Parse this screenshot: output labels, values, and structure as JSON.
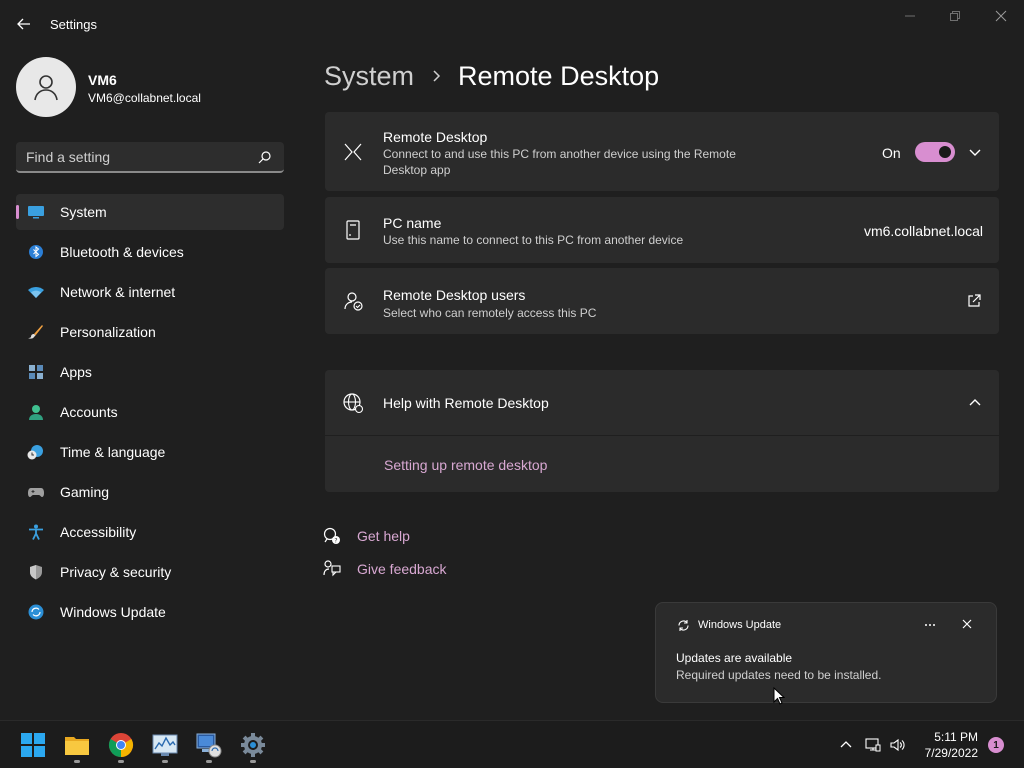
{
  "window": {
    "title": "Settings",
    "icons": [
      "back-arrow-icon",
      "minimize-icon",
      "maximize-icon",
      "close-icon"
    ]
  },
  "profile": {
    "name": "VM6",
    "email": "VM6@collabnet.local"
  },
  "search": {
    "placeholder": "Find a setting"
  },
  "nav": {
    "items": [
      {
        "label": "System",
        "icon": "monitor-icon",
        "selected": true
      },
      {
        "label": "Bluetooth & devices",
        "icon": "bluetooth-icon"
      },
      {
        "label": "Network & internet",
        "icon": "wifi-icon"
      },
      {
        "label": "Personalization",
        "icon": "brush-icon"
      },
      {
        "label": "Apps",
        "icon": "apps-icon"
      },
      {
        "label": "Accounts",
        "icon": "person-icon"
      },
      {
        "label": "Time & language",
        "icon": "clock-globe-icon"
      },
      {
        "label": "Gaming",
        "icon": "gamepad-icon"
      },
      {
        "label": "Accessibility",
        "icon": "accessibility-icon"
      },
      {
        "label": "Privacy & security",
        "icon": "shield-icon"
      },
      {
        "label": "Windows Update",
        "icon": "update-icon"
      }
    ]
  },
  "breadcrumb": {
    "parent": "System",
    "current": "Remote Desktop"
  },
  "cards": {
    "remote_desktop": {
      "title": "Remote Desktop",
      "description": "Connect to and use this PC from another device using the Remote Desktop app",
      "toggle_label": "On",
      "toggle_on": true
    },
    "pc_name": {
      "title": "PC name",
      "description": "Use this name to connect to this PC from another device",
      "value": "vm6.collabnet.local"
    },
    "users": {
      "title": "Remote Desktop users",
      "description": "Select who can remotely access this PC"
    },
    "help": {
      "title": "Help with Remote Desktop",
      "link": "Setting up remote desktop"
    }
  },
  "footer_links": {
    "get_help": "Get help",
    "give_feedback": "Give feedback"
  },
  "toast": {
    "app_name": "Windows Update",
    "title": "Updates are available",
    "body": "Required updates need to be installed."
  },
  "taskbar": {
    "time": "5:11 PM",
    "date": "7/29/2022",
    "notification_count": "1"
  },
  "colors": {
    "accent": "#d88ed0",
    "background": "#1f1f1f",
    "card": "#2b2b2b"
  }
}
